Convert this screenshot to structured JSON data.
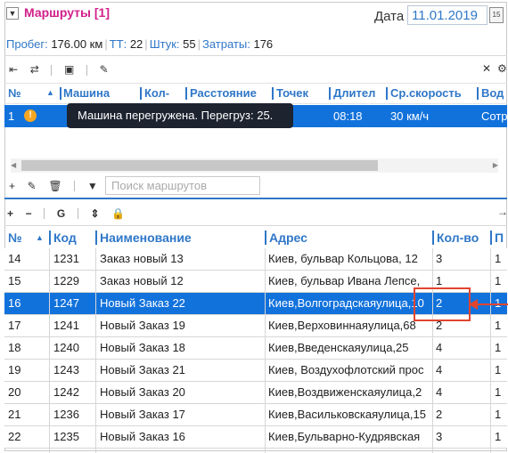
{
  "header": {
    "title": "Маршруты [1]",
    "date_label": "Дата",
    "date_value": "11.01.2019",
    "calendar_day": "15"
  },
  "summary": {
    "mileage_label": "Пробег:",
    "mileage_value": "176.00 км",
    "tt_label": "ТТ:",
    "tt_value": "22",
    "pieces_label": "Штук:",
    "pieces_value": "55",
    "costs_label": "Затраты:",
    "costs_value": "176"
  },
  "routes": {
    "columns": [
      "№",
      "Машина",
      "Кол-",
      "Расстояние",
      "Точек",
      "Длител",
      "Ср.скорость",
      "Вод"
    ],
    "row": {
      "num": "1",
      "warn": "!",
      "duration": "08:18",
      "speed": "30 км/ч",
      "driver": "Сотр"
    },
    "tooltip": "Машина перегружена. Перегруз: 25."
  },
  "search": {
    "placeholder": "Поиск маршрутов"
  },
  "toolbar3": {
    "g_label": "G"
  },
  "orders": {
    "columns": [
      "№",
      "Код",
      "Наименование",
      "Адрес",
      "Кол-во",
      "П"
    ],
    "rows": [
      {
        "num": "14",
        "code": "1231",
        "name": "Заказ новый 13",
        "address": "Киев, бульвар Кольцова, 12",
        "qty": "3",
        "p": "1"
      },
      {
        "num": "15",
        "code": "1229",
        "name": "Заказ новый 12",
        "address": "Киев, бульвар Ивана Лепсе,",
        "qty": "1",
        "p": "1"
      },
      {
        "num": "16",
        "code": "1247",
        "name": "Новый Заказ 22",
        "address": "Киев,Волгоградскаяулица,10",
        "qty": "2",
        "p": "1"
      },
      {
        "num": "17",
        "code": "1241",
        "name": "Новый Заказ 19",
        "address": "Киев,Верховиннаяулица,68",
        "qty": "2",
        "p": "1"
      },
      {
        "num": "18",
        "code": "1240",
        "name": "Новый Заказ 18",
        "address": "Киев,Введенскаяулица,25",
        "qty": "4",
        "p": "1"
      },
      {
        "num": "19",
        "code": "1243",
        "name": "Новый Заказ 21",
        "address": "Киев, Воздухофлотский прос",
        "qty": "4",
        "p": "1"
      },
      {
        "num": "20",
        "code": "1242",
        "name": "Новый Заказ 20",
        "address": "Киев,Воздвиженскаяулица,2",
        "qty": "4",
        "p": "1"
      },
      {
        "num": "21",
        "code": "1236",
        "name": "Новый Заказ 17",
        "address": "Киев,Васильковскаяулица,15",
        "qty": "2",
        "p": "1"
      },
      {
        "num": "22",
        "code": "1235",
        "name": "Новый Заказ 16",
        "address": "Киев,Бульварно-Кудрявская",
        "qty": "3",
        "p": "1"
      }
    ]
  }
}
